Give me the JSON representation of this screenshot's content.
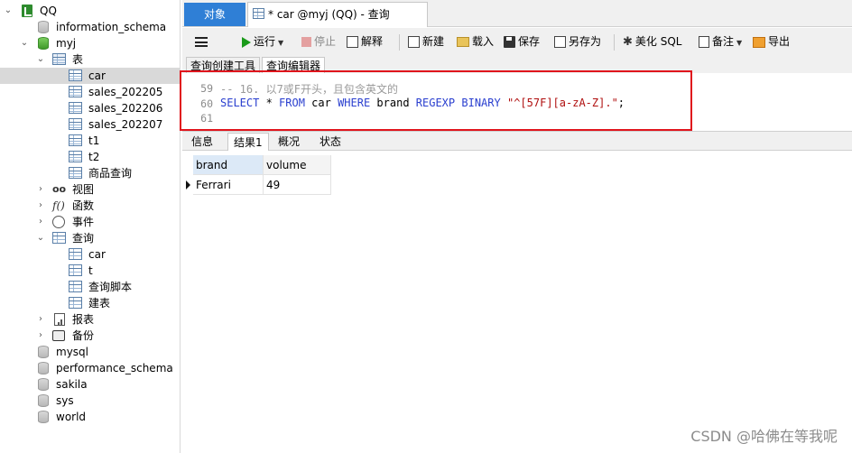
{
  "tree": {
    "connection": "QQ",
    "databases_top": [
      "information_schema"
    ],
    "current_db": "myj",
    "tables_group": "表",
    "tables": [
      "car",
      "sales_202205",
      "sales_202206",
      "sales_202207",
      "t1",
      "t2",
      "商品查询"
    ],
    "views_group": "视图",
    "functions_group": "函数",
    "events_group": "事件",
    "queries_group": "查询",
    "queries": [
      "car",
      "t",
      "查询脚本",
      "建表"
    ],
    "reports_group": "报表",
    "backup_group": "备份",
    "databases_bottom": [
      "mysql",
      "performance_schema",
      "sakila",
      "sys",
      "world"
    ],
    "func_icon_text": "f()",
    "view_icon_text": "oo"
  },
  "tabs": {
    "objects": "对象",
    "query": "* car @myj (QQ) - 查询"
  },
  "toolbar": {
    "run": "运行",
    "stop": "停止",
    "explain": "解释",
    "new": "新建",
    "load": "载入",
    "save": "保存",
    "save_as": "另存为",
    "beautify": "美化 SQL",
    "note": "备注",
    "export": "导出"
  },
  "subtabs": {
    "builder": "查询创建工具",
    "editor": "查询编辑器"
  },
  "editor": {
    "lines": [
      {
        "num": "59",
        "comment": "-- 16. 以7或F开头，且包含英文的"
      },
      {
        "num": "60",
        "kw1": "SELECT",
        "t1": " * ",
        "kw2": "FROM",
        "t2": " car ",
        "kw3": "WHERE",
        "t3": " brand ",
        "kw4": "REGEXP",
        "t4": " ",
        "kw5": "BINARY",
        "t5": " ",
        "str": "\"^[57F][a-zA-Z].\"",
        "end": ";"
      },
      {
        "num": "61"
      }
    ]
  },
  "result_tabs": [
    "信息",
    "结果1",
    "概况",
    "状态"
  ],
  "grid": {
    "columns": [
      "brand",
      "volume"
    ],
    "rows": [
      [
        "Ferrari",
        "49"
      ]
    ]
  },
  "watermark": "CSDN @哈佛在等我呢",
  "colors": {
    "accent_tab": "#2f7fd6",
    "highlight_box": "#e0141c",
    "keyword": "#2a3fcf",
    "string": "#b01010",
    "comment": "#9a9a9a"
  }
}
